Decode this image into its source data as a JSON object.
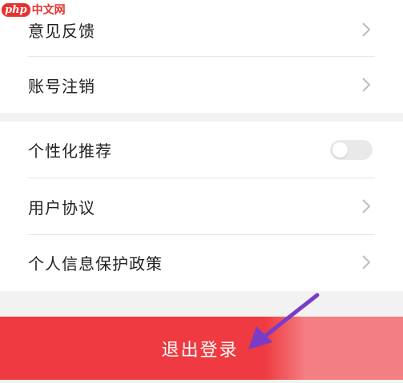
{
  "watermark": {
    "brand": "php",
    "site": "中文网"
  },
  "settings": {
    "feedback": "意见反馈",
    "account_cancel": "账号注销",
    "personalized_recommend": "个性化推荐",
    "personalized_recommend_on": false,
    "user_agreement": "用户协议",
    "privacy_policy": "个人信息保护政策"
  },
  "logout": {
    "label": "退出登录"
  },
  "colors": {
    "accent_red": "#ee3a40",
    "arrow_purple": "#7a3cc8",
    "toggle_off": "#e9e9e9"
  }
}
